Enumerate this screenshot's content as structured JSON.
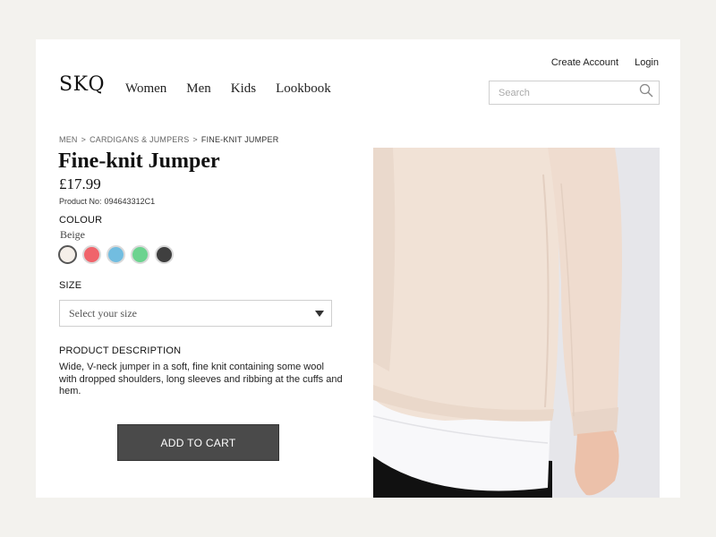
{
  "header": {
    "logo": "SKQ",
    "nav": [
      "Women",
      "Men",
      "Kids",
      "Lookbook"
    ],
    "links": {
      "create_account": "Create Account",
      "login": "Login"
    },
    "search": {
      "placeholder": "Search",
      "icon": "search-icon"
    }
  },
  "breadcrumb": {
    "items": [
      "MEN",
      "CARDIGANS & JUMPERS"
    ],
    "separator": ">",
    "current": "FINE-KNIT JUMPER"
  },
  "product": {
    "title": "Fine-knit Jumper",
    "price": "£17.99",
    "product_no_label": "Product No:",
    "product_no": "094643312C1",
    "colour_label": "COLOUR",
    "selected_colour": "Beige",
    "colours": [
      "#f5efe9",
      "#f0646b",
      "#72bde0",
      "#6cd38f",
      "#3f3f3f"
    ],
    "size_label": "SIZE",
    "size_placeholder": "Select your size",
    "description_label": "PRODUCT DESCRIPTION",
    "description": "Wide, V-neck jumper in a soft, fine knit containing some wool with dropped shoulders, long sleeves and ribbing at the cuffs and hem.",
    "add_to_cart": "ADD TO CART"
  },
  "colors": {
    "page_bg": "#f3f2ee",
    "button_bg": "#4a4a4a",
    "jumper": "#f1e2d6",
    "photo_bg": "#e6e6ea"
  }
}
